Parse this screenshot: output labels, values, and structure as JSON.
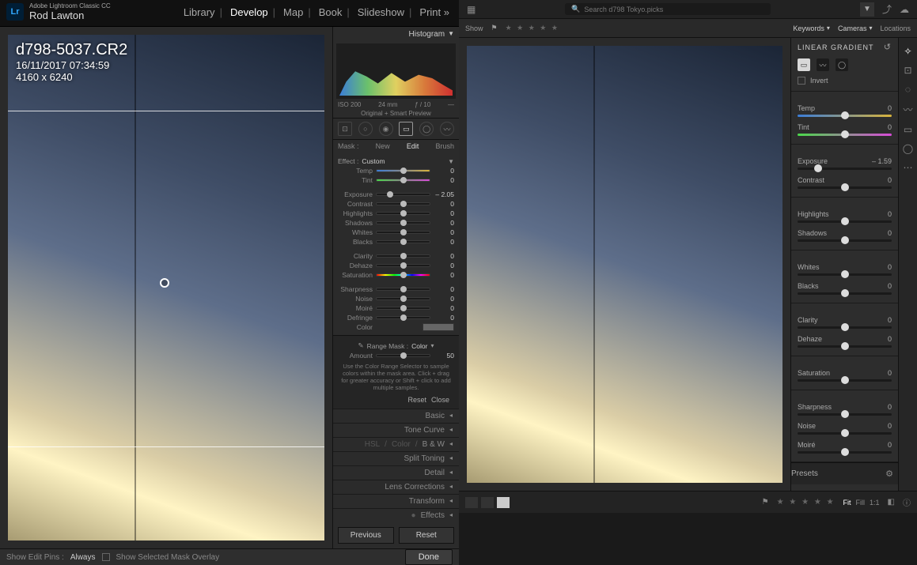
{
  "lrc": {
    "brand_small": "Adobe Lightroom Classic CC",
    "brand_user": "Rod Lawton",
    "logo": "Lr",
    "modules": [
      "Library",
      "Develop",
      "Map",
      "Book",
      "Slideshow",
      "Print »"
    ],
    "active_module": "Develop",
    "meta": {
      "filename": "d798-5037.CR2",
      "datetime": "16/11/2017 07:34:59",
      "dims": "4160 x 6240"
    },
    "footbar": {
      "show_edit_pins": "Show Edit Pins :",
      "always": "Always",
      "overlay": "Show Selected Mask Overlay",
      "done": "Done"
    },
    "histogram": {
      "title": "Histogram",
      "iso": "ISO 200",
      "focal": "24 mm",
      "aperture": "ƒ / 10",
      "shutter": "—",
      "preview": "Original + Smart Preview"
    },
    "tabs": {
      "mask": "Mask :",
      "new": "New",
      "edit": "Edit",
      "brush": "Brush"
    },
    "effect": {
      "label": "Effect :",
      "value": "Custom"
    },
    "sliders": {
      "temp": {
        "label": "Temp",
        "val": "0"
      },
      "tint": {
        "label": "Tint",
        "val": "0"
      },
      "exposure": {
        "label": "Exposure",
        "val": "– 2.05"
      },
      "contrast": {
        "label": "Contrast",
        "val": "0"
      },
      "highlights": {
        "label": "Highlights",
        "val": "0"
      },
      "shadows": {
        "label": "Shadows",
        "val": "0"
      },
      "whites": {
        "label": "Whites",
        "val": "0"
      },
      "blacks": {
        "label": "Blacks",
        "val": "0"
      },
      "clarity": {
        "label": "Clarity",
        "val": "0"
      },
      "dehaze": {
        "label": "Dehaze",
        "val": "0"
      },
      "saturation": {
        "label": "Saturation",
        "val": "0"
      },
      "sharpness": {
        "label": "Sharpness",
        "val": "0"
      },
      "noise": {
        "label": "Noise",
        "val": "0"
      },
      "moire": {
        "label": "Moiré",
        "val": "0"
      },
      "defringe": {
        "label": "Defringe",
        "val": "0"
      },
      "color": {
        "label": "Color"
      }
    },
    "range_mask": {
      "label": "Range Mask :",
      "mode": "Color",
      "amount_label": "Amount",
      "amount_val": "50",
      "help": "Use the Color Range Selector to sample colors within the mask area. Click + drag for greater accuracy or Shift + click to add multiple samples.",
      "reset": "Reset",
      "close": "Close"
    },
    "panels": {
      "basic": "Basic",
      "tone_curve": "Tone Curve",
      "hsl": "HSL",
      "hsl_sep": "/",
      "color": "Color",
      "bw": "B & W",
      "split_toning": "Split Toning",
      "detail": "Detail",
      "lens_corr": "Lens Corrections",
      "transform": "Transform",
      "effects": "Effects"
    },
    "prev_reset": {
      "previous": "Previous",
      "reset": "Reset"
    }
  },
  "lrcc": {
    "search_placeholder": "Search d798 Tokyo.picks",
    "filterbar": {
      "show": "Show",
      "keywords": "Keywords",
      "cameras": "Cameras",
      "locations": "Locations"
    },
    "panel_title": "LINEAR GRADIENT",
    "invert": "Invert",
    "sliders": {
      "temp": {
        "label": "Temp",
        "val": "0"
      },
      "tint": {
        "label": "Tint",
        "val": "0"
      },
      "exposure": {
        "label": "Exposure",
        "val": "– 1.59"
      },
      "contrast": {
        "label": "Contrast",
        "val": "0"
      },
      "highlights": {
        "label": "Highlights",
        "val": "0"
      },
      "shadows": {
        "label": "Shadows",
        "val": "0"
      },
      "whites": {
        "label": "Whites",
        "val": "0"
      },
      "blacks": {
        "label": "Blacks",
        "val": "0"
      },
      "clarity": {
        "label": "Clarity",
        "val": "0"
      },
      "dehaze": {
        "label": "Dehaze",
        "val": "0"
      },
      "saturation": {
        "label": "Saturation",
        "val": "0"
      },
      "sharpness": {
        "label": "Sharpness",
        "val": "0"
      },
      "noise": {
        "label": "Noise",
        "val": "0"
      },
      "moire": {
        "label": "Moiré",
        "val": "0"
      }
    },
    "foot": {
      "fit": "Fit",
      "fill": "Fill",
      "oneone": "1:1"
    },
    "presets": "Presets"
  }
}
